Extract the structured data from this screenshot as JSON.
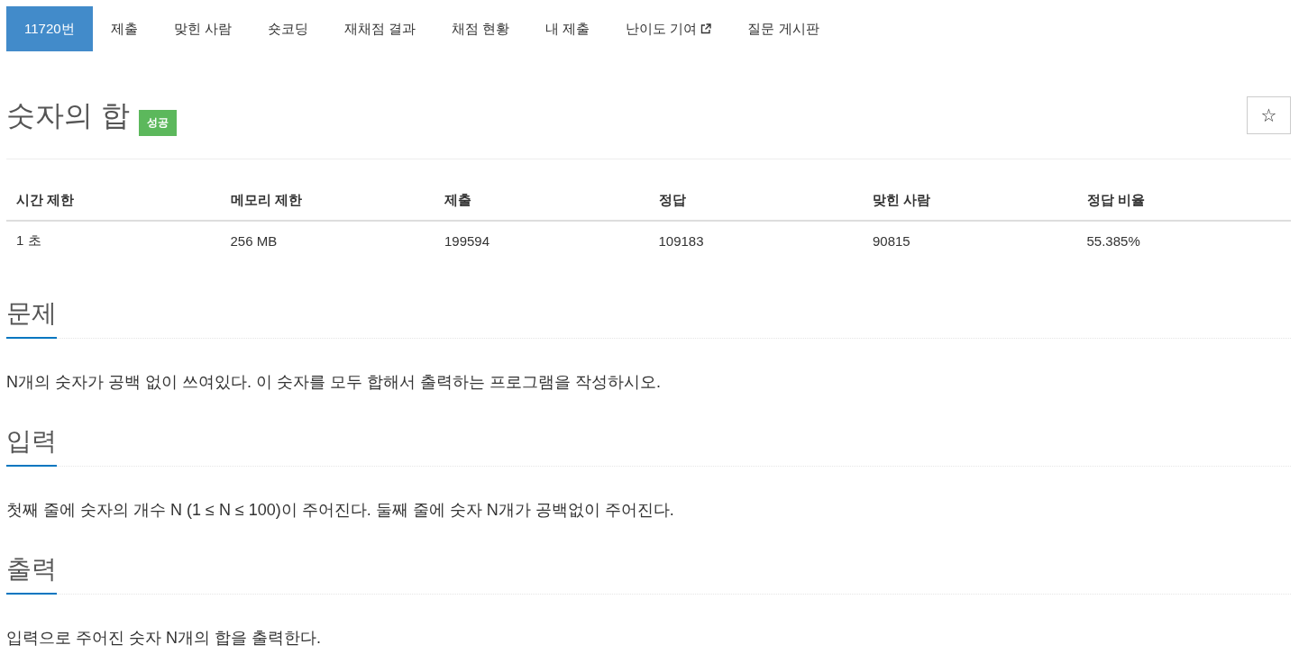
{
  "tabs": [
    {
      "label": "11720번",
      "selected": true,
      "kind": "link"
    },
    {
      "label": "제출",
      "selected": false,
      "kind": "link"
    },
    {
      "label": "맞힌 사람",
      "selected": false,
      "kind": "link"
    },
    {
      "label": "숏코딩",
      "selected": false,
      "kind": "link"
    },
    {
      "label": "재채점 결과",
      "selected": false,
      "kind": "link"
    },
    {
      "label": "채점 현황",
      "selected": false,
      "kind": "link"
    },
    {
      "label": "내 제출",
      "selected": false,
      "kind": "link"
    },
    {
      "label": "난이도 기여",
      "selected": false,
      "kind": "external_link"
    },
    {
      "label": "질문 게시판",
      "selected": false,
      "kind": "link"
    }
  ],
  "problem": {
    "title": "숫자의 합",
    "status": {
      "label": "성공",
      "kind": "success"
    },
    "star_button": {
      "label": "☆"
    }
  },
  "limits_table": {
    "columns": [
      "시간 제한",
      "메모리 제한",
      "제출",
      "정답",
      "맞힌 사람",
      "정답 비율"
    ],
    "rows": [
      [
        "1 초",
        "256 MB",
        "199594",
        "109183",
        "90815",
        "55.385%"
      ]
    ]
  },
  "sections": [
    {
      "heading": "문제",
      "text": "N개의 숫자가 공백 없이 쓰여있다. 이 숫자를 모두 합해서 출력하는 프로그램을 작성하시오."
    },
    {
      "heading": "입력",
      "text": "첫째 줄에 숫자의 개수 N (1 ≤ N ≤ 100)이 주어진다. 둘째 줄에 숫자 N개가 공백없이 주어진다."
    },
    {
      "heading": "출력",
      "text": "입력으로 주어진 숫자 N개의 합을 출력한다."
    }
  ]
}
